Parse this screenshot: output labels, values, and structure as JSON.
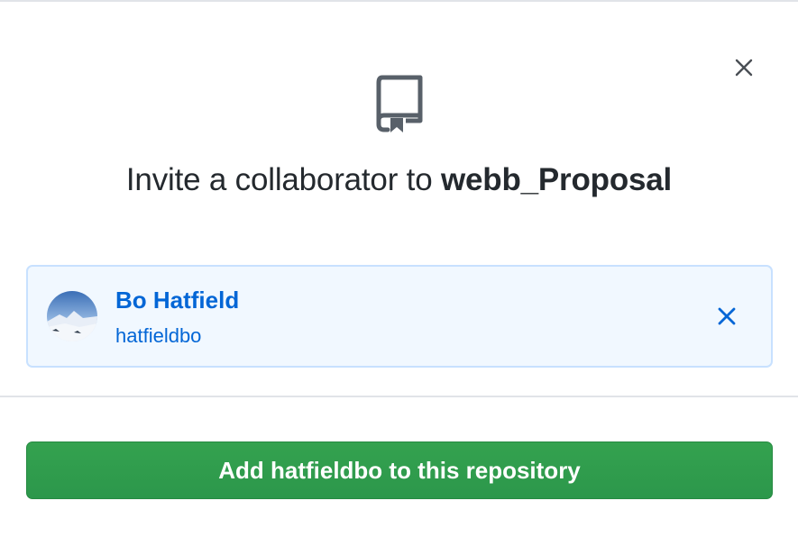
{
  "dialog": {
    "title_prefix": "Invite a collaborator to",
    "repo_name": "webb_Proposal",
    "close_icon": "close-icon",
    "repo_icon": "repo-icon"
  },
  "selected_user": {
    "name": "Bo Hatfield",
    "login": "hatfieldbo",
    "avatar_icon": "avatar",
    "remove_icon": "close-icon"
  },
  "actions": {
    "add_button_label": "Add hatfieldbo to this repository"
  },
  "colors": {
    "link_blue": "#0366d6",
    "card_bg": "#f1f8ff",
    "card_border": "#c8e1ff",
    "button_green": "#2ea44f",
    "text_dark": "#24292e",
    "icon_gray": "#586069"
  }
}
